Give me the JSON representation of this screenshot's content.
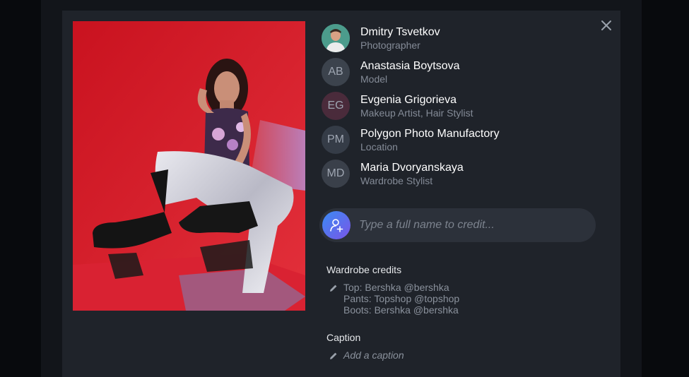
{
  "credits": [
    {
      "name": "Dmitry Tsvetkov",
      "role": "Photographer",
      "initials": "",
      "avatar_color": "#3f8f86"
    },
    {
      "name": "Anastasia Boytsova",
      "role": "Model",
      "initials": "AB",
      "avatar_color": "#3c434d"
    },
    {
      "name": "Evgenia Grigorieva",
      "role": "Makeup Artist, Hair Stylist",
      "initials": "EG",
      "avatar_color": "#4a2b3b"
    },
    {
      "name": "Polygon Photo Manufactory",
      "role": "Location",
      "initials": "PM",
      "avatar_color": "#353c47"
    },
    {
      "name": "Maria Dvoryanskaya",
      "role": "Wardrobe Stylist",
      "initials": "MD",
      "avatar_color": "#3a404a"
    }
  ],
  "credit_input": {
    "placeholder": "Type a full name to credit..."
  },
  "wardrobe": {
    "label": "Wardrobe credits",
    "lines": [
      "Top: Bershka @bershka",
      "Pants: Topshop @topshop",
      "Boots: Bershka @bershka"
    ]
  },
  "caption": {
    "label": "Caption",
    "placeholder": "Add a caption"
  },
  "colors": {
    "modal_bg": "#1f232a",
    "accent_start": "#3a8bf5",
    "accent_end": "#7a55e6",
    "photo_bg": "#cf1d2a"
  }
}
